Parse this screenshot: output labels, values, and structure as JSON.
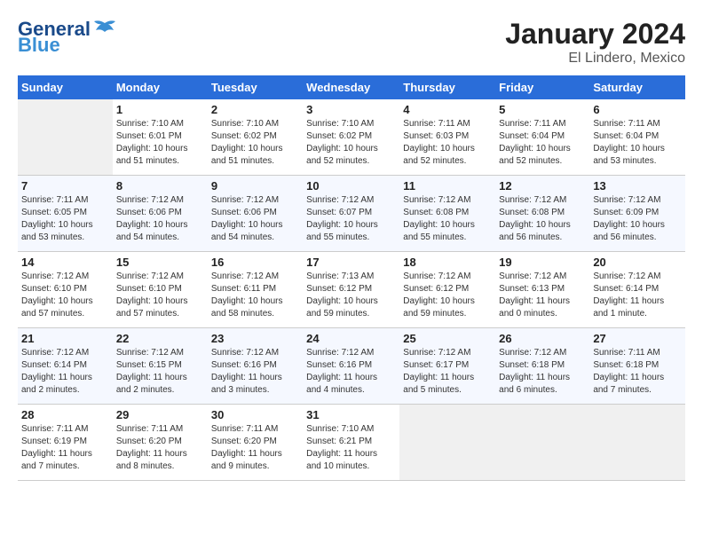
{
  "header": {
    "logo_general": "General",
    "logo_blue": "Blue",
    "title": "January 2024",
    "subtitle": "El Lindero, Mexico"
  },
  "weekdays": [
    "Sunday",
    "Monday",
    "Tuesday",
    "Wednesday",
    "Thursday",
    "Friday",
    "Saturday"
  ],
  "weeks": [
    [
      {
        "day": "",
        "info": ""
      },
      {
        "day": "1",
        "info": "Sunrise: 7:10 AM\nSunset: 6:01 PM\nDaylight: 10 hours\nand 51 minutes."
      },
      {
        "day": "2",
        "info": "Sunrise: 7:10 AM\nSunset: 6:02 PM\nDaylight: 10 hours\nand 51 minutes."
      },
      {
        "day": "3",
        "info": "Sunrise: 7:10 AM\nSunset: 6:02 PM\nDaylight: 10 hours\nand 52 minutes."
      },
      {
        "day": "4",
        "info": "Sunrise: 7:11 AM\nSunset: 6:03 PM\nDaylight: 10 hours\nand 52 minutes."
      },
      {
        "day": "5",
        "info": "Sunrise: 7:11 AM\nSunset: 6:04 PM\nDaylight: 10 hours\nand 52 minutes."
      },
      {
        "day": "6",
        "info": "Sunrise: 7:11 AM\nSunset: 6:04 PM\nDaylight: 10 hours\nand 53 minutes."
      }
    ],
    [
      {
        "day": "7",
        "info": "Sunrise: 7:11 AM\nSunset: 6:05 PM\nDaylight: 10 hours\nand 53 minutes."
      },
      {
        "day": "8",
        "info": "Sunrise: 7:12 AM\nSunset: 6:06 PM\nDaylight: 10 hours\nand 54 minutes."
      },
      {
        "day": "9",
        "info": "Sunrise: 7:12 AM\nSunset: 6:06 PM\nDaylight: 10 hours\nand 54 minutes."
      },
      {
        "day": "10",
        "info": "Sunrise: 7:12 AM\nSunset: 6:07 PM\nDaylight: 10 hours\nand 55 minutes."
      },
      {
        "day": "11",
        "info": "Sunrise: 7:12 AM\nSunset: 6:08 PM\nDaylight: 10 hours\nand 55 minutes."
      },
      {
        "day": "12",
        "info": "Sunrise: 7:12 AM\nSunset: 6:08 PM\nDaylight: 10 hours\nand 56 minutes."
      },
      {
        "day": "13",
        "info": "Sunrise: 7:12 AM\nSunset: 6:09 PM\nDaylight: 10 hours\nand 56 minutes."
      }
    ],
    [
      {
        "day": "14",
        "info": "Sunrise: 7:12 AM\nSunset: 6:10 PM\nDaylight: 10 hours\nand 57 minutes."
      },
      {
        "day": "15",
        "info": "Sunrise: 7:12 AM\nSunset: 6:10 PM\nDaylight: 10 hours\nand 57 minutes."
      },
      {
        "day": "16",
        "info": "Sunrise: 7:12 AM\nSunset: 6:11 PM\nDaylight: 10 hours\nand 58 minutes."
      },
      {
        "day": "17",
        "info": "Sunrise: 7:13 AM\nSunset: 6:12 PM\nDaylight: 10 hours\nand 59 minutes."
      },
      {
        "day": "18",
        "info": "Sunrise: 7:12 AM\nSunset: 6:12 PM\nDaylight: 10 hours\nand 59 minutes."
      },
      {
        "day": "19",
        "info": "Sunrise: 7:12 AM\nSunset: 6:13 PM\nDaylight: 11 hours\nand 0 minutes."
      },
      {
        "day": "20",
        "info": "Sunrise: 7:12 AM\nSunset: 6:14 PM\nDaylight: 11 hours\nand 1 minute."
      }
    ],
    [
      {
        "day": "21",
        "info": "Sunrise: 7:12 AM\nSunset: 6:14 PM\nDaylight: 11 hours\nand 2 minutes."
      },
      {
        "day": "22",
        "info": "Sunrise: 7:12 AM\nSunset: 6:15 PM\nDaylight: 11 hours\nand 2 minutes."
      },
      {
        "day": "23",
        "info": "Sunrise: 7:12 AM\nSunset: 6:16 PM\nDaylight: 11 hours\nand 3 minutes."
      },
      {
        "day": "24",
        "info": "Sunrise: 7:12 AM\nSunset: 6:16 PM\nDaylight: 11 hours\nand 4 minutes."
      },
      {
        "day": "25",
        "info": "Sunrise: 7:12 AM\nSunset: 6:17 PM\nDaylight: 11 hours\nand 5 minutes."
      },
      {
        "day": "26",
        "info": "Sunrise: 7:12 AM\nSunset: 6:18 PM\nDaylight: 11 hours\nand 6 minutes."
      },
      {
        "day": "27",
        "info": "Sunrise: 7:11 AM\nSunset: 6:18 PM\nDaylight: 11 hours\nand 7 minutes."
      }
    ],
    [
      {
        "day": "28",
        "info": "Sunrise: 7:11 AM\nSunset: 6:19 PM\nDaylight: 11 hours\nand 7 minutes."
      },
      {
        "day": "29",
        "info": "Sunrise: 7:11 AM\nSunset: 6:20 PM\nDaylight: 11 hours\nand 8 minutes."
      },
      {
        "day": "30",
        "info": "Sunrise: 7:11 AM\nSunset: 6:20 PM\nDaylight: 11 hours\nand 9 minutes."
      },
      {
        "day": "31",
        "info": "Sunrise: 7:10 AM\nSunset: 6:21 PM\nDaylight: 11 hours\nand 10 minutes."
      },
      {
        "day": "",
        "info": ""
      },
      {
        "day": "",
        "info": ""
      },
      {
        "day": "",
        "info": ""
      }
    ]
  ]
}
